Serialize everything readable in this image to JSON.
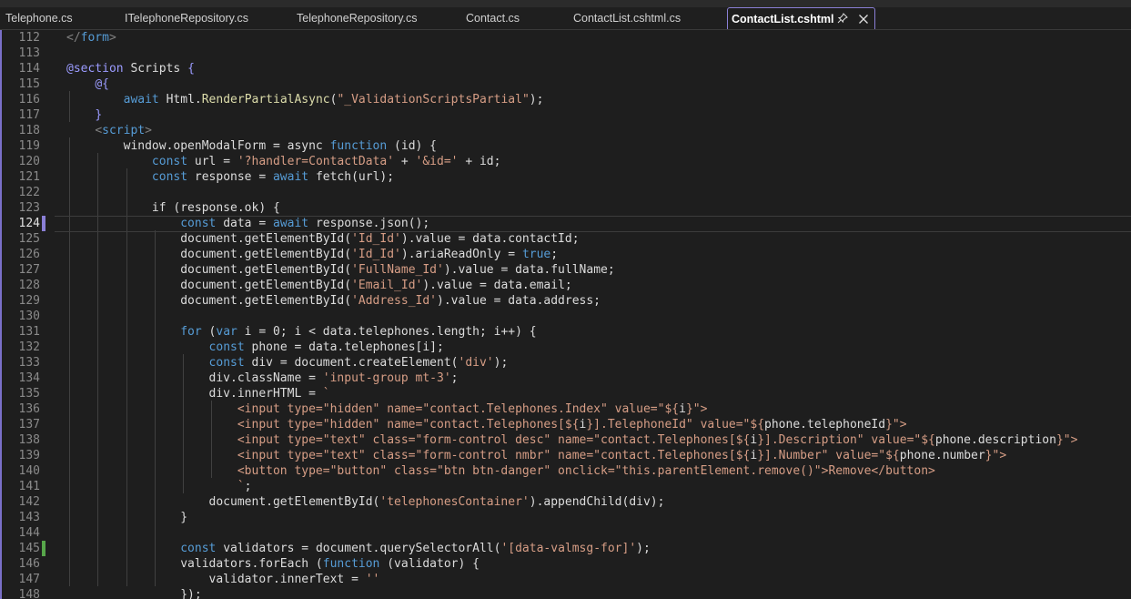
{
  "tabs": [
    {
      "label": "Telephone.cs"
    },
    {
      "label": "ITelephoneRepository.cs"
    },
    {
      "label": "TelephoneRepository.cs"
    },
    {
      "label": "Contact.cs"
    },
    {
      "label": "ContactList.cshtml.cs"
    },
    {
      "label": "ContactList.cshtml"
    }
  ],
  "active_tab": 5,
  "icons": {
    "pin": "pin-icon",
    "close": "close-icon"
  },
  "colors": {
    "keyword": "#569cd6",
    "string": "#d69d85",
    "method": "#dcdcaa",
    "directive": "#9b9bff",
    "accent": "#8a7fd6",
    "changed_marker": "#57a64a"
  },
  "current_line": "124",
  "lines": [
    {
      "n": "112",
      "marker": "",
      "tokens": [
        [
          "g",
          "</"
        ],
        [
          "k",
          "form"
        ],
        [
          "g",
          ">"
        ]
      ]
    },
    {
      "n": "113",
      "marker": "",
      "tokens": []
    },
    {
      "n": "114",
      "marker": "",
      "tokens": [
        [
          "d",
          "@section"
        ],
        [
          "w",
          " Scripts "
        ],
        [
          "d",
          "{"
        ]
      ]
    },
    {
      "n": "115",
      "marker": "",
      "tokens": [
        [
          "w",
          "    "
        ],
        [
          "d",
          "@{"
        ]
      ]
    },
    {
      "n": "116",
      "marker": "",
      "tokens": [
        [
          "w",
          "        "
        ],
        [
          "k",
          "await"
        ],
        [
          "w",
          " Html."
        ],
        [
          "m",
          "RenderPartialAsync"
        ],
        [
          "w",
          "("
        ],
        [
          "s",
          "\"_ValidationScriptsPartial\""
        ],
        [
          "w",
          ");"
        ]
      ]
    },
    {
      "n": "117",
      "marker": "",
      "tokens": [
        [
          "w",
          "    "
        ],
        [
          "d",
          "}"
        ]
      ]
    },
    {
      "n": "118",
      "marker": "",
      "tokens": [
        [
          "w",
          "    "
        ],
        [
          "g",
          "<"
        ],
        [
          "k",
          "script"
        ],
        [
          "g",
          ">"
        ]
      ]
    },
    {
      "n": "119",
      "marker": "",
      "tokens": [
        [
          "w",
          "        window.openModalForm = async "
        ],
        [
          "k",
          "function"
        ],
        [
          "w",
          " (id) {"
        ]
      ]
    },
    {
      "n": "120",
      "marker": "",
      "tokens": [
        [
          "w",
          "            "
        ],
        [
          "k",
          "const"
        ],
        [
          "w",
          " url = "
        ],
        [
          "s",
          "'?handler=ContactData'"
        ],
        [
          "w",
          " + "
        ],
        [
          "s",
          "'&id='"
        ],
        [
          "w",
          " + id;"
        ]
      ]
    },
    {
      "n": "121",
      "marker": "",
      "tokens": [
        [
          "w",
          "            "
        ],
        [
          "k",
          "const"
        ],
        [
          "w",
          " response = "
        ],
        [
          "k",
          "await"
        ],
        [
          "w",
          " fetch(url);"
        ]
      ]
    },
    {
      "n": "122",
      "marker": "",
      "tokens": []
    },
    {
      "n": "123",
      "marker": "",
      "tokens": [
        [
          "w",
          "            if (response.ok) {"
        ]
      ]
    },
    {
      "n": "124",
      "marker": "purple",
      "tokens": [
        [
          "w",
          "                "
        ],
        [
          "k",
          "const"
        ],
        [
          "w",
          " data = "
        ],
        [
          "k",
          "await"
        ],
        [
          "w",
          " response.json();"
        ]
      ]
    },
    {
      "n": "125",
      "marker": "",
      "tokens": [
        [
          "w",
          "                document.getElementById("
        ],
        [
          "s",
          "'Id_Id'"
        ],
        [
          "w",
          ").value = data.contactId;"
        ]
      ]
    },
    {
      "n": "126",
      "marker": "",
      "tokens": [
        [
          "w",
          "                document.getElementById("
        ],
        [
          "s",
          "'Id_Id'"
        ],
        [
          "w",
          ").ariaReadOnly = "
        ],
        [
          "k",
          "true"
        ],
        [
          "w",
          ";"
        ]
      ]
    },
    {
      "n": "127",
      "marker": "",
      "tokens": [
        [
          "w",
          "                document.getElementById("
        ],
        [
          "s",
          "'FullName_Id'"
        ],
        [
          "w",
          ").value = data.fullName;"
        ]
      ]
    },
    {
      "n": "128",
      "marker": "",
      "tokens": [
        [
          "w",
          "                document.getElementById("
        ],
        [
          "s",
          "'Email_Id'"
        ],
        [
          "w",
          ").value = data.email;"
        ]
      ]
    },
    {
      "n": "129",
      "marker": "",
      "tokens": [
        [
          "w",
          "                document.getElementById("
        ],
        [
          "s",
          "'Address_Id'"
        ],
        [
          "w",
          ").value = data.address;"
        ]
      ]
    },
    {
      "n": "130",
      "marker": "",
      "tokens": []
    },
    {
      "n": "131",
      "marker": "",
      "tokens": [
        [
          "w",
          "                "
        ],
        [
          "k",
          "for"
        ],
        [
          "w",
          " ("
        ],
        [
          "k",
          "var"
        ],
        [
          "w",
          " i = 0; i < data.telephones.length; i++) {"
        ]
      ]
    },
    {
      "n": "132",
      "marker": "",
      "tokens": [
        [
          "w",
          "                    "
        ],
        [
          "k",
          "const"
        ],
        [
          "w",
          " phone = data.telephones[i];"
        ]
      ]
    },
    {
      "n": "133",
      "marker": "",
      "tokens": [
        [
          "w",
          "                    "
        ],
        [
          "k",
          "const"
        ],
        [
          "w",
          " div = document.createElement("
        ],
        [
          "s",
          "'div'"
        ],
        [
          "w",
          ");"
        ]
      ]
    },
    {
      "n": "134",
      "marker": "",
      "tokens": [
        [
          "w",
          "                    div.className = "
        ],
        [
          "s",
          "'input-group mt-3'"
        ],
        [
          "w",
          ";"
        ]
      ]
    },
    {
      "n": "135",
      "marker": "",
      "tokens": [
        [
          "w",
          "                    div.innerHTML = "
        ],
        [
          "t",
          "`"
        ]
      ]
    },
    {
      "n": "136",
      "marker": "",
      "tokens": [
        [
          "w",
          "                        "
        ],
        [
          "t",
          "<input type=\"hidden\" name=\"contact.Telephones.Index\" value=\"${"
        ],
        [
          "w",
          "i"
        ],
        [
          "t",
          "}\">"
        ]
      ]
    },
    {
      "n": "137",
      "marker": "",
      "tokens": [
        [
          "w",
          "                        "
        ],
        [
          "t",
          "<input type=\"hidden\" name=\"contact.Telephones[${"
        ],
        [
          "w",
          "i"
        ],
        [
          "t",
          "}].TelephoneId\" value=\"${"
        ],
        [
          "w",
          "phone.telephoneId"
        ],
        [
          "t",
          "}\">"
        ]
      ]
    },
    {
      "n": "138",
      "marker": "",
      "tokens": [
        [
          "w",
          "                        "
        ],
        [
          "t",
          "<input type=\"text\" class=\"form-control desc\" name=\"contact.Telephones[${"
        ],
        [
          "w",
          "i"
        ],
        [
          "t",
          "}].Description\" value=\"${"
        ],
        [
          "w",
          "phone.description"
        ],
        [
          "t",
          "}\">"
        ]
      ]
    },
    {
      "n": "139",
      "marker": "",
      "tokens": [
        [
          "w",
          "                        "
        ],
        [
          "t",
          "<input type=\"text\" class=\"form-control nmbr\" name=\"contact.Telephones[${"
        ],
        [
          "w",
          "i"
        ],
        [
          "t",
          "}].Number\" value=\"${"
        ],
        [
          "w",
          "phone.number"
        ],
        [
          "t",
          "}\">"
        ]
      ]
    },
    {
      "n": "140",
      "marker": "",
      "tokens": [
        [
          "w",
          "                        "
        ],
        [
          "t",
          "<button type=\"button\" class=\"btn btn-danger\" onclick=\"this.parentElement.remove()\">Remove</button>"
        ]
      ]
    },
    {
      "n": "141",
      "marker": "",
      "tokens": [
        [
          "w",
          "                        "
        ],
        [
          "t",
          "`"
        ],
        [
          "w",
          ";"
        ]
      ]
    },
    {
      "n": "142",
      "marker": "",
      "tokens": [
        [
          "w",
          "                    document.getElementById("
        ],
        [
          "s",
          "'telephonesContainer'"
        ],
        [
          "w",
          ").appendChild(div);"
        ]
      ]
    },
    {
      "n": "143",
      "marker": "",
      "tokens": [
        [
          "w",
          "                }"
        ]
      ]
    },
    {
      "n": "144",
      "marker": "",
      "tokens": []
    },
    {
      "n": "145",
      "marker": "green",
      "tokens": [
        [
          "w",
          "                "
        ],
        [
          "k",
          "const"
        ],
        [
          "w",
          " validators = document.querySelectorAll("
        ],
        [
          "s",
          "'[data-valmsg-for]'"
        ],
        [
          "w",
          ");"
        ]
      ]
    },
    {
      "n": "146",
      "marker": "",
      "tokens": [
        [
          "w",
          "                validators.forEach ("
        ],
        [
          "k",
          "function"
        ],
        [
          "w",
          " (validator) {"
        ]
      ]
    },
    {
      "n": "147",
      "marker": "",
      "tokens": [
        [
          "w",
          "                    validator.innerText = "
        ],
        [
          "s",
          "''"
        ]
      ]
    },
    {
      "n": "148",
      "marker": "",
      "tokens": [
        [
          "w",
          "                });"
        ]
      ]
    }
  ]
}
